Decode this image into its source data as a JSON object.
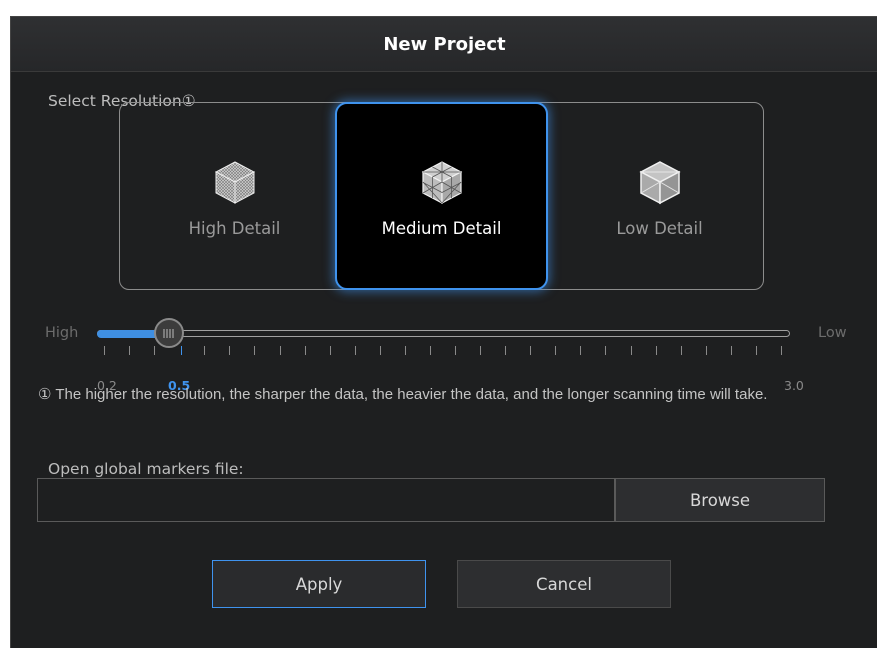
{
  "dialog": {
    "title": "New Project"
  },
  "resolution": {
    "label": "Select Resolution①",
    "options": [
      {
        "label": "High Detail",
        "icon": "cube-high-detail-icon",
        "selected": false
      },
      {
        "label": "Medium Detail",
        "icon": "cube-medium-detail-icon",
        "selected": true
      },
      {
        "label": "Low Detail",
        "icon": "cube-low-detail-icon",
        "selected": false
      }
    ]
  },
  "slider": {
    "left_label": "High",
    "right_label": "Low",
    "min_label": "0.2",
    "current_label": "0.5",
    "max_label": "3.0",
    "min": 0.2,
    "max": 3.0,
    "value": 0.5
  },
  "note": "① The higher the resolution, the sharper the data, the heavier the data, and the longer scanning time will take.",
  "markers": {
    "label": "Open global markers file:",
    "value": "",
    "browse_label": "Browse"
  },
  "buttons": {
    "apply": "Apply",
    "cancel": "Cancel"
  },
  "colors": {
    "accent": "#3f93ee",
    "background": "#1e1f20"
  }
}
